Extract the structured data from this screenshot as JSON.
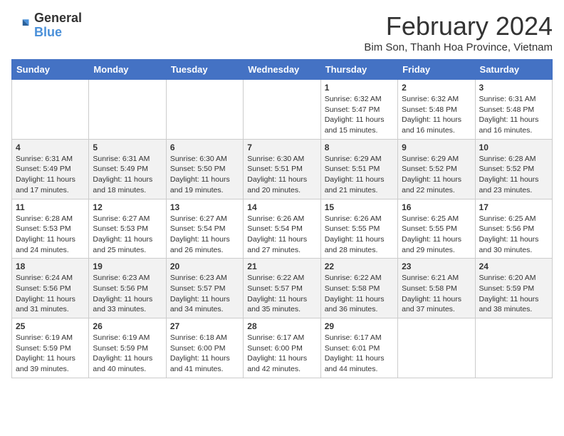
{
  "header": {
    "logo_general": "General",
    "logo_blue": "Blue",
    "month_title": "February 2024",
    "location": "Bim Son, Thanh Hoa Province, Vietnam"
  },
  "days_of_week": [
    "Sunday",
    "Monday",
    "Tuesday",
    "Wednesday",
    "Thursday",
    "Friday",
    "Saturday"
  ],
  "weeks": [
    [
      {
        "day": "",
        "info": ""
      },
      {
        "day": "",
        "info": ""
      },
      {
        "day": "",
        "info": ""
      },
      {
        "day": "",
        "info": ""
      },
      {
        "day": "1",
        "info": "Sunrise: 6:32 AM\nSunset: 5:47 PM\nDaylight: 11 hours and 15 minutes."
      },
      {
        "day": "2",
        "info": "Sunrise: 6:32 AM\nSunset: 5:48 PM\nDaylight: 11 hours and 16 minutes."
      },
      {
        "day": "3",
        "info": "Sunrise: 6:31 AM\nSunset: 5:48 PM\nDaylight: 11 hours and 16 minutes."
      }
    ],
    [
      {
        "day": "4",
        "info": "Sunrise: 6:31 AM\nSunset: 5:49 PM\nDaylight: 11 hours and 17 minutes."
      },
      {
        "day": "5",
        "info": "Sunrise: 6:31 AM\nSunset: 5:49 PM\nDaylight: 11 hours and 18 minutes."
      },
      {
        "day": "6",
        "info": "Sunrise: 6:30 AM\nSunset: 5:50 PM\nDaylight: 11 hours and 19 minutes."
      },
      {
        "day": "7",
        "info": "Sunrise: 6:30 AM\nSunset: 5:51 PM\nDaylight: 11 hours and 20 minutes."
      },
      {
        "day": "8",
        "info": "Sunrise: 6:29 AM\nSunset: 5:51 PM\nDaylight: 11 hours and 21 minutes."
      },
      {
        "day": "9",
        "info": "Sunrise: 6:29 AM\nSunset: 5:52 PM\nDaylight: 11 hours and 22 minutes."
      },
      {
        "day": "10",
        "info": "Sunrise: 6:28 AM\nSunset: 5:52 PM\nDaylight: 11 hours and 23 minutes."
      }
    ],
    [
      {
        "day": "11",
        "info": "Sunrise: 6:28 AM\nSunset: 5:53 PM\nDaylight: 11 hours and 24 minutes."
      },
      {
        "day": "12",
        "info": "Sunrise: 6:27 AM\nSunset: 5:53 PM\nDaylight: 11 hours and 25 minutes."
      },
      {
        "day": "13",
        "info": "Sunrise: 6:27 AM\nSunset: 5:54 PM\nDaylight: 11 hours and 26 minutes."
      },
      {
        "day": "14",
        "info": "Sunrise: 6:26 AM\nSunset: 5:54 PM\nDaylight: 11 hours and 27 minutes."
      },
      {
        "day": "15",
        "info": "Sunrise: 6:26 AM\nSunset: 5:55 PM\nDaylight: 11 hours and 28 minutes."
      },
      {
        "day": "16",
        "info": "Sunrise: 6:25 AM\nSunset: 5:55 PM\nDaylight: 11 hours and 29 minutes."
      },
      {
        "day": "17",
        "info": "Sunrise: 6:25 AM\nSunset: 5:56 PM\nDaylight: 11 hours and 30 minutes."
      }
    ],
    [
      {
        "day": "18",
        "info": "Sunrise: 6:24 AM\nSunset: 5:56 PM\nDaylight: 11 hours and 31 minutes."
      },
      {
        "day": "19",
        "info": "Sunrise: 6:23 AM\nSunset: 5:56 PM\nDaylight: 11 hours and 33 minutes."
      },
      {
        "day": "20",
        "info": "Sunrise: 6:23 AM\nSunset: 5:57 PM\nDaylight: 11 hours and 34 minutes."
      },
      {
        "day": "21",
        "info": "Sunrise: 6:22 AM\nSunset: 5:57 PM\nDaylight: 11 hours and 35 minutes."
      },
      {
        "day": "22",
        "info": "Sunrise: 6:22 AM\nSunset: 5:58 PM\nDaylight: 11 hours and 36 minutes."
      },
      {
        "day": "23",
        "info": "Sunrise: 6:21 AM\nSunset: 5:58 PM\nDaylight: 11 hours and 37 minutes."
      },
      {
        "day": "24",
        "info": "Sunrise: 6:20 AM\nSunset: 5:59 PM\nDaylight: 11 hours and 38 minutes."
      }
    ],
    [
      {
        "day": "25",
        "info": "Sunrise: 6:19 AM\nSunset: 5:59 PM\nDaylight: 11 hours and 39 minutes."
      },
      {
        "day": "26",
        "info": "Sunrise: 6:19 AM\nSunset: 5:59 PM\nDaylight: 11 hours and 40 minutes."
      },
      {
        "day": "27",
        "info": "Sunrise: 6:18 AM\nSunset: 6:00 PM\nDaylight: 11 hours and 41 minutes."
      },
      {
        "day": "28",
        "info": "Sunrise: 6:17 AM\nSunset: 6:00 PM\nDaylight: 11 hours and 42 minutes."
      },
      {
        "day": "29",
        "info": "Sunrise: 6:17 AM\nSunset: 6:01 PM\nDaylight: 11 hours and 44 minutes."
      },
      {
        "day": "",
        "info": ""
      },
      {
        "day": "",
        "info": ""
      }
    ]
  ]
}
